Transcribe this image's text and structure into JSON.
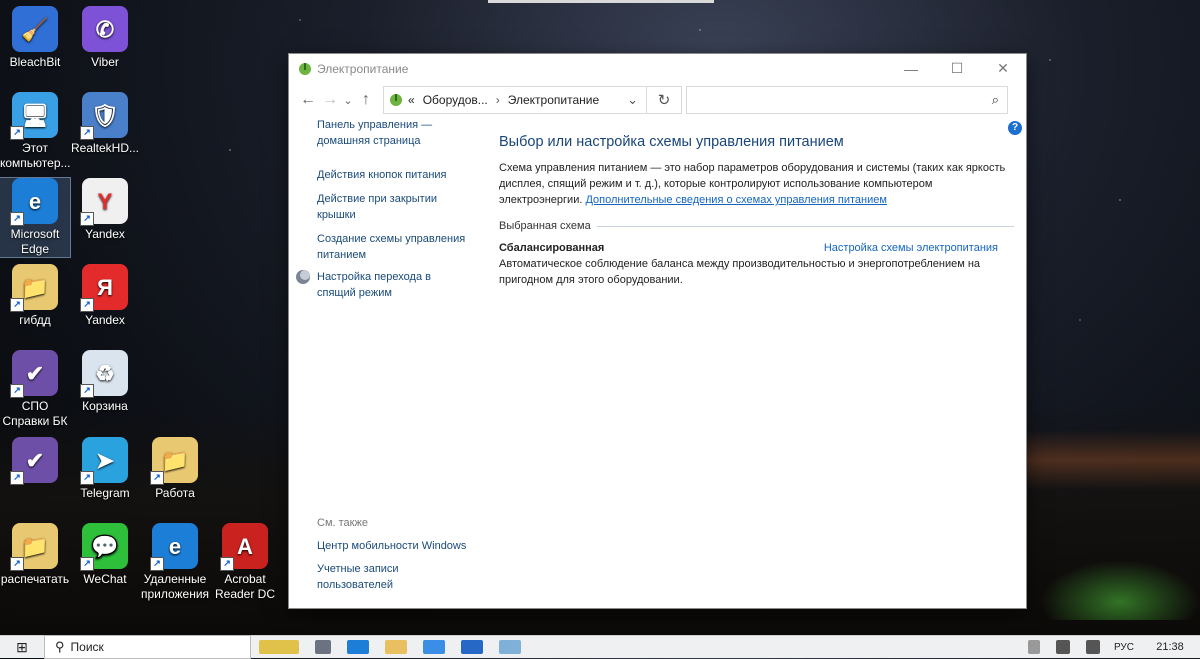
{
  "desktop": {
    "icons": [
      {
        "label": "BleachBit",
        "glyph": "🧹",
        "color": "#2f6fd6"
      },
      {
        "label": "Viber",
        "glyph": "✆",
        "color": "#7d52d6"
      },
      {
        "label": "Этот компьютер...",
        "glyph": "🖥",
        "color": "#3aa0e6"
      },
      {
        "label": "RealtekHD...",
        "glyph": "🛡",
        "color": "#4a7fc9"
      },
      {
        "label": "Microsoft Edge",
        "glyph": "e",
        "color": "#1c7ed6"
      },
      {
        "label": "Yandex",
        "glyph": "Y",
        "color": "#f0f0f0"
      },
      {
        "label": "гибдд",
        "glyph": "📁",
        "color": "#e8c870"
      },
      {
        "label": "Yandex",
        "glyph": "Я",
        "color": "#e42b2b"
      },
      {
        "label": "СПО Справки БК",
        "glyph": "✔",
        "color": "#6e4fa8"
      },
      {
        "label": "Корзина",
        "glyph": "♻",
        "color": "#d9e4ee"
      },
      {
        "label": "",
        "glyph": "✔",
        "color": "#6e4fa8"
      },
      {
        "label": "Telegram",
        "glyph": "➤",
        "color": "#2aa2de"
      },
      {
        "label": "Работа",
        "glyph": "📁",
        "color": "#e8c870"
      },
      {
        "label": "распечатать",
        "glyph": "📁",
        "color": "#e8c870"
      },
      {
        "label": "WeChat",
        "glyph": "💬",
        "color": "#2ebf3b"
      },
      {
        "label": "Удаленные приложения",
        "glyph": "e",
        "color": "#1c7ed6"
      },
      {
        "label": "Acrobat Reader DC",
        "glyph": "A",
        "color": "#c9221f"
      }
    ]
  },
  "window": {
    "title": "Электропитание",
    "controls": {
      "minimize": "—",
      "maximize": "☐",
      "close": "✕"
    },
    "address": {
      "prefix": "«",
      "crumbs": [
        "Оборудов...",
        "Электропитание"
      ],
      "separator": "›",
      "dropdown": "⌄",
      "refresh": "↻"
    },
    "nav": {
      "back": "←",
      "forward": "→",
      "recent": "⌄",
      "up": "↑"
    },
    "search": {
      "placeholder": "",
      "icon": "⌕"
    },
    "help": "?",
    "sidebar": {
      "links": [
        "Панель управления — домашняя страница",
        "Действия кнопок питания",
        "Действие при закрытии крышки",
        "Создание схемы управления питанием",
        "Настройка перехода в спящий режим"
      ],
      "see_also_label": "См. также",
      "see_also": [
        "Центр мобильности Windows",
        "Учетные записи пользователей"
      ]
    },
    "main": {
      "heading": "Выбор или настройка схемы управления питанием",
      "description": "Схема управления питанием — это набор параметров оборудования и системы (таких как яркость дисплея, спящий режим и т. д.), которые контролируют использование компьютером электроэнергии.",
      "more_link": "Дополнительные сведения о схемах управления питанием",
      "group_label": "Выбранная схема",
      "plan_name": "Сбалансированная",
      "plan_link": "Настройка схемы электропитания",
      "plan_desc": "Автоматическое соблюдение баланса между производительностью и энергопотреблением на пригодном для этого оборудовании."
    }
  },
  "taskbar": {
    "start": "⊞",
    "search_placeholder": "Поиск",
    "search_icon": "⚲",
    "lang": "РУС",
    "time": "21:38"
  }
}
